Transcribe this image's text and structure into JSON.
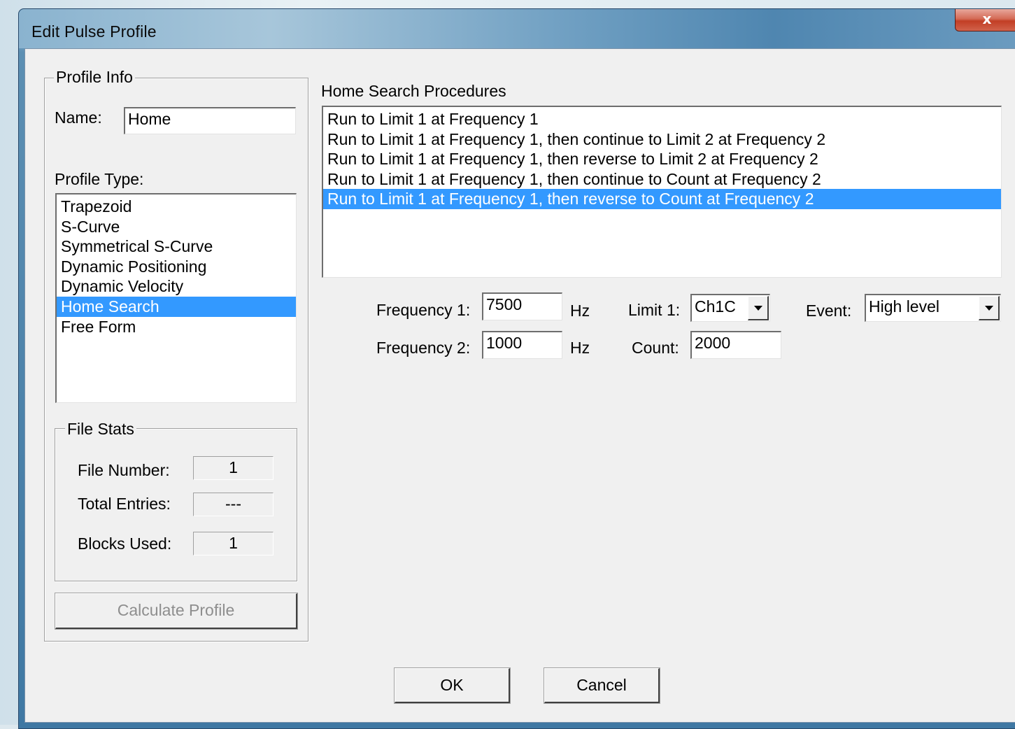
{
  "window": {
    "title": "Edit Pulse Profile",
    "close_glyph": "x"
  },
  "profile_info": {
    "group_label": "Profile Info",
    "name_label": "Name:",
    "name_value": "Home",
    "profile_type_label": "Profile Type:",
    "profile_types": [
      "Trapezoid",
      "S-Curve",
      "Symmetrical S-Curve",
      "Dynamic Positioning",
      "Dynamic Velocity",
      "Home Search",
      "Free Form"
    ],
    "selected_profile_type": "Home Search"
  },
  "file_stats": {
    "group_label": "File Stats",
    "file_number_label": "File Number:",
    "file_number_value": "1",
    "total_entries_label": "Total Entries:",
    "total_entries_value": "---",
    "blocks_used_label": "Blocks Used:",
    "blocks_used_value": "1"
  },
  "calculate_button_label": "Calculate Profile",
  "home_search": {
    "label": "Home Search Procedures",
    "procedures": [
      "Run to Limit 1 at Frequency 1",
      "Run to Limit 1 at Frequency 1, then continue to Limit 2 at Frequency 2",
      "Run to Limit 1 at Frequency 1, then reverse to Limit 2 at Frequency 2",
      "Run to Limit 1 at Frequency 1, then continue to Count at Frequency 2",
      "Run to Limit 1 at Frequency 1, then reverse to Count at Frequency 2"
    ],
    "selected_procedure": "Run to Limit 1 at Frequency 1, then reverse to Count at Frequency 2"
  },
  "params": {
    "frequency1_label": "Frequency 1:",
    "frequency1_value": "7500",
    "frequency1_unit": "Hz",
    "frequency2_label": "Frequency 2:",
    "frequency2_value": "1000",
    "frequency2_unit": "Hz",
    "limit1_label": "Limit 1:",
    "limit1_value": "Ch1C",
    "count_label": "Count:",
    "count_value": "2000",
    "event_label": "Event:",
    "event_value": "High level"
  },
  "buttons": {
    "ok": "OK",
    "cancel": "Cancel"
  },
  "colors": {
    "selection": "#3399ff",
    "dialog_bg": "#f0f0f0"
  }
}
